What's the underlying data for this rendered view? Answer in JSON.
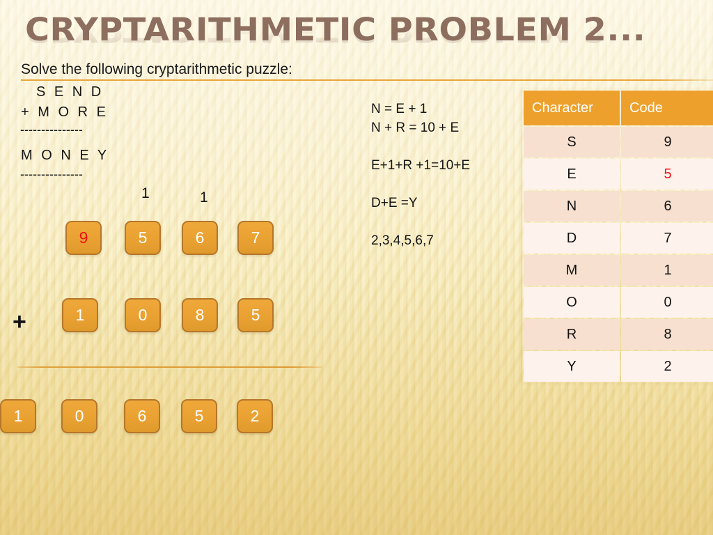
{
  "slide": {
    "title": "CRYPTARITHMETIC PROBLEM 2...",
    "intro": "Solve the following cryptarithmetic puzzle:",
    "puzzle": {
      "addend1": "S E N D",
      "addend2": "+ M O R E",
      "rule_top": "---------------",
      "sum": "M O N E Y",
      "rule_bottom": "---------------"
    },
    "plus_sign": "+",
    "carries": [
      "1",
      "1"
    ],
    "rows": {
      "addend1_digits": [
        "9",
        "5",
        "6",
        "7"
      ],
      "addend2_digits": [
        "1",
        "0",
        "8",
        "5"
      ],
      "result_digits": [
        "1",
        "0",
        "6",
        "5",
        "2"
      ]
    },
    "equations": [
      "N = E + 1",
      "N + R = 10 + E",
      "E+1+R +1=10+E",
      "D+E =Y",
      "2,3,4,5,6,7"
    ],
    "table": {
      "headers": [
        "Character",
        "Code"
      ],
      "rows": [
        {
          "character": "S",
          "code": "9"
        },
        {
          "character": "E",
          "code": "5"
        },
        {
          "character": "N",
          "code": "6"
        },
        {
          "character": "D",
          "code": "7"
        },
        {
          "character": "M",
          "code": "1"
        },
        {
          "character": "O",
          "code": "0"
        },
        {
          "character": "R",
          "code": "8"
        },
        {
          "character": "Y",
          "code": "2"
        }
      ]
    },
    "colors": {
      "title": "#8d6e5f",
      "accent": "#e8a53a",
      "table_header": "#eda12c",
      "highlight": "#ee1111",
      "box_fill": "#e9a132",
      "box_border": "#b5762a",
      "background": "#f8ecba"
    }
  }
}
